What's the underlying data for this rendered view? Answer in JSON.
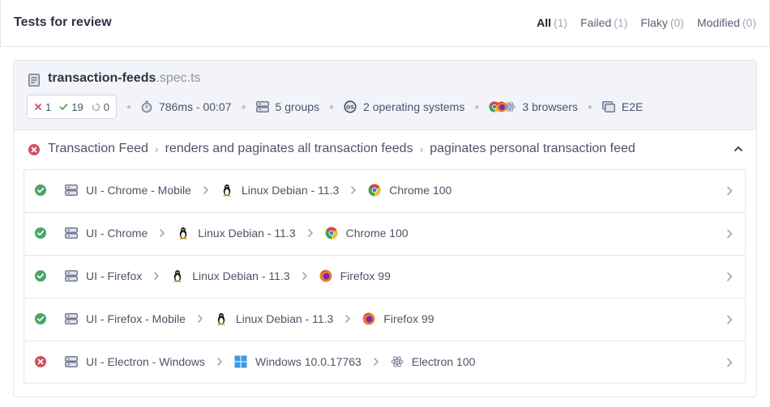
{
  "header": {
    "title": "Tests for review",
    "filters": [
      {
        "label": "All",
        "count": "(1)"
      },
      {
        "label": "Failed",
        "count": "(1)"
      },
      {
        "label": "Flaky",
        "count": "(0)"
      },
      {
        "label": "Modified",
        "count": "(0)"
      }
    ]
  },
  "spec": {
    "name": "transaction-feeds",
    "ext": ".spec.ts",
    "failed": "1",
    "passed": "19",
    "pending": "0",
    "duration": "786ms - 00:07",
    "groups": "5 groups",
    "os": "2 operating systems",
    "browsers": "3 browsers",
    "type": "E2E"
  },
  "test": {
    "crumbs": [
      "Transaction Feed",
      "renders and paginates all transaction feeds",
      "paginates personal transaction feed"
    ]
  },
  "runs": [
    {
      "status": "passed",
      "group": "UI - Chrome - Mobile",
      "os": "Linux Debian - 11.3",
      "os_icon": "linux-icon",
      "browser": "Chrome 100",
      "browser_icon": "chrome-icon"
    },
    {
      "status": "passed",
      "group": "UI - Chrome",
      "os": "Linux Debian - 11.3",
      "os_icon": "linux-icon",
      "browser": "Chrome 100",
      "browser_icon": "chrome-icon"
    },
    {
      "status": "passed",
      "group": "UI - Firefox",
      "os": "Linux Debian - 11.3",
      "os_icon": "linux-icon",
      "browser": "Firefox 99",
      "browser_icon": "firefox-icon"
    },
    {
      "status": "passed",
      "group": "UI - Firefox - Mobile",
      "os": "Linux Debian - 11.3",
      "os_icon": "linux-icon",
      "browser": "Firefox 99",
      "browser_icon": "firefox-icon"
    },
    {
      "status": "failed",
      "group": "UI - Electron - Windows",
      "os": "Windows 10.0.17763",
      "os_icon": "windows-icon",
      "browser": "Electron 100",
      "browser_icon": "electron-icon"
    }
  ],
  "colors": {
    "pass": "#4aa867",
    "fail": "#d24f5e",
    "accent": "#2d3344"
  }
}
